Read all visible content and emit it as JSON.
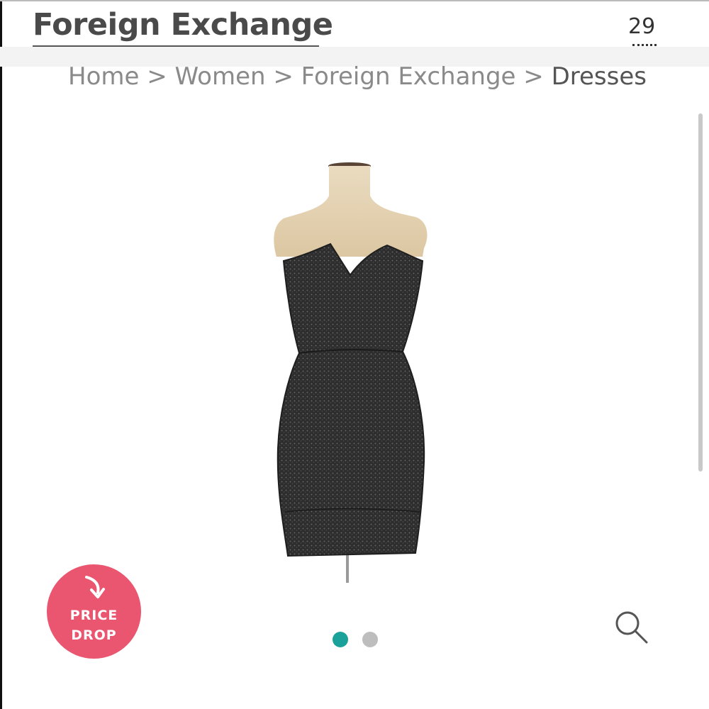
{
  "header": {
    "brand": "Foreign Exchange",
    "counter": "29"
  },
  "breadcrumb": {
    "items": [
      "Home",
      "Women",
      "Foreign Exchange",
      "Dresses"
    ],
    "separator": ">"
  },
  "product": {
    "image_alt": "Black sparkle strapless dress on mannequin"
  },
  "badge": {
    "line1": "PRICE",
    "line2": "DROP"
  },
  "carousel": {
    "total": 2,
    "active_index": 0
  },
  "colors": {
    "badge": "#ea5670",
    "dot_active": "#1aa199",
    "dot_inactive": "#bdbdbd"
  },
  "icons": [
    "arrow-down-right-icon",
    "search-icon"
  ]
}
